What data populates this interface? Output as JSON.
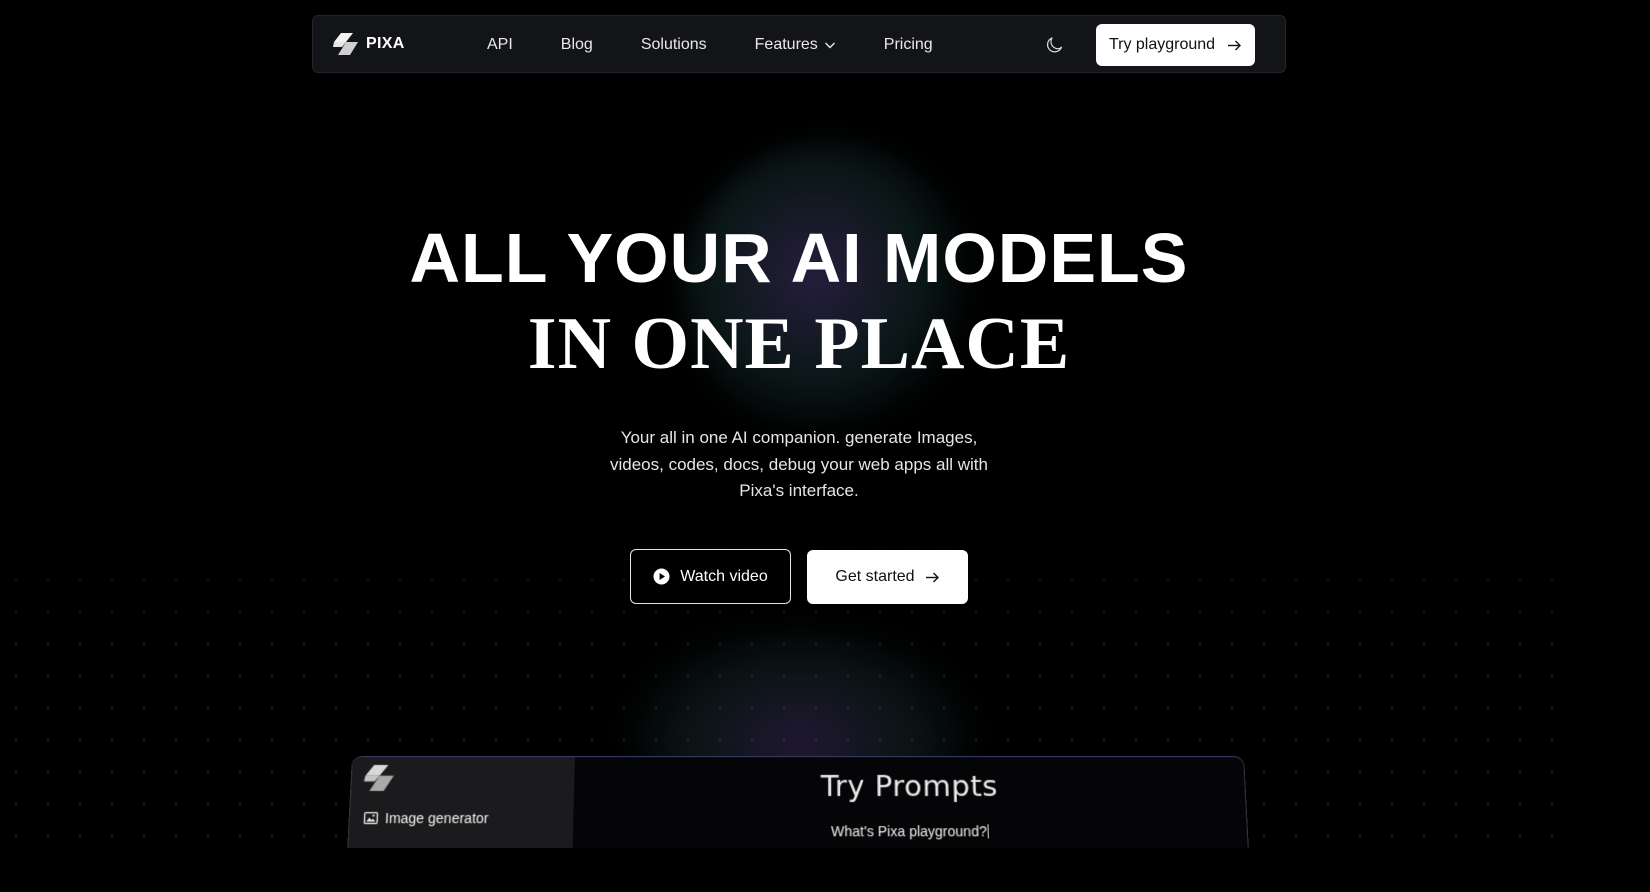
{
  "brand": {
    "name": "PIXA",
    "logo_icon": "pixa-logo-icon"
  },
  "nav": {
    "links": [
      {
        "label": "API"
      },
      {
        "label": "Blog"
      },
      {
        "label": "Solutions"
      },
      {
        "label": "Features",
        "has_dropdown": true
      },
      {
        "label": "Pricing"
      }
    ],
    "theme_toggle_icon": "moon-icon",
    "cta_label": "Try playground"
  },
  "hero": {
    "title_line1": "ALL YOUR AI MODELS",
    "title_line2": "IN ONE PLACE",
    "subtitle": "Your all in one AI companion. generate Images, videos, codes, docs, debug your web apps all with Pixa's interface.",
    "watch_label": "Watch video",
    "start_label": "Get started"
  },
  "playground": {
    "sidebar_item": "Image generator",
    "title": "Try Prompts",
    "prompt": "What's Pixa playground?"
  },
  "colors": {
    "background": "#000000",
    "nav_bg": "#131418",
    "button_light": "#ffffff",
    "sidebar_bg": "#1b1b1d"
  }
}
